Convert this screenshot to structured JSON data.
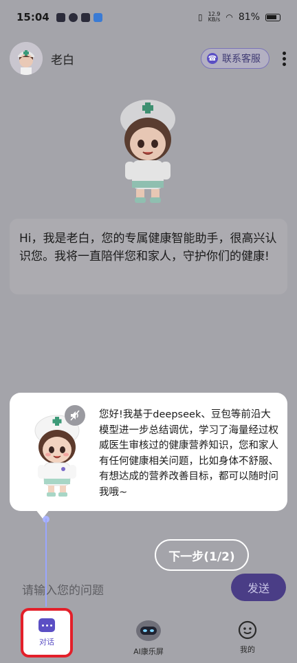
{
  "status_bar": {
    "time": "15:04",
    "net_speed_value": "12.9",
    "net_speed_unit": "KB/s",
    "battery": "81%"
  },
  "header": {
    "name": "老白",
    "service_label": "联系客服"
  },
  "greeting": {
    "text": "Hi，我是老白，您的专属健康智能助手，很高兴认识您。我将一直陪伴您和家人，守护你们的健康!"
  },
  "guide": {
    "text": "您好!我基于deepseek、豆包等前沿大模型进一步总结调优，学习了海量经过权威医生审核过的健康营养知识，您和家人有任何健康相关问题，比如身体不舒服、有想达成的营养改善目标，都可以随时问我哦~",
    "next_label": "下一步(1/2)"
  },
  "input": {
    "placeholder": "请输入您的问题",
    "send_label": "发送"
  },
  "tabs": [
    {
      "label": "对话",
      "icon": "chat-icon",
      "active": true
    },
    {
      "label": "AI康乐屏",
      "icon": "robot-icon",
      "active": false
    },
    {
      "label": "我的",
      "icon": "smile-icon",
      "active": false
    }
  ],
  "colors": {
    "accent": "#5b4fc4",
    "highlight_border": "#e3202a",
    "overlay": "#a4a4aa"
  }
}
